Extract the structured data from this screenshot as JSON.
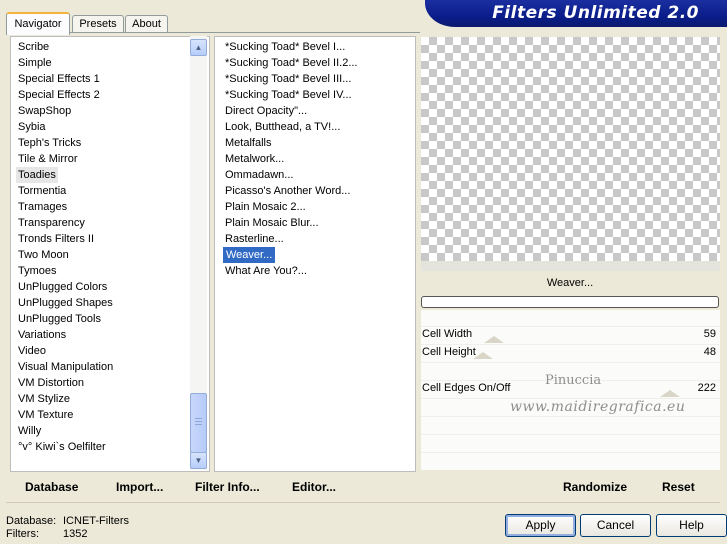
{
  "app": {
    "title": "Filters Unlimited 2.0"
  },
  "tabs": [
    {
      "label": "Navigator",
      "active": true
    },
    {
      "label": "Presets",
      "active": false
    },
    {
      "label": "About",
      "active": false
    }
  ],
  "categories": {
    "items": [
      "Scribe",
      "Simple",
      "Special Effects 1",
      "Special Effects 2",
      "SwapShop",
      "Sybia",
      "Teph's Tricks",
      "Tile & Mirror",
      "Toadies",
      "Tormentia",
      "Tramages",
      "Transparency",
      "Tronds Filters II",
      "Two Moon",
      "Tymoes",
      "UnPlugged Colors",
      "UnPlugged Shapes",
      "UnPlugged Tools",
      "Variations",
      "Video",
      "Visual Manipulation",
      "VM Distortion",
      "VM Stylize",
      "VM Texture",
      "Willy",
      "°v° Kiwi`s Oelfilter"
    ],
    "selected": "Toadies"
  },
  "filters": {
    "items": [
      "*Sucking Toad*  Bevel I...",
      "*Sucking Toad*  Bevel II.2...",
      "*Sucking Toad*  Bevel III...",
      "*Sucking Toad*  Bevel IV...",
      "Direct Opacity\"...",
      "Look, Butthead, a TV!...",
      "Metalfalls",
      "Metalwork...",
      "Ommadawn...",
      "Picasso's Another Word...",
      "Plain Mosaic 2...",
      "Plain Mosaic Blur...",
      "Rasterline...",
      "Weaver...",
      "What Are You?..."
    ],
    "selected": "Weaver..."
  },
  "preview": {
    "filter_name": "Weaver...",
    "progress": 0
  },
  "controls": [
    {
      "label": "Cell Width",
      "value": "59",
      "fraction": 0.23
    },
    {
      "label": "Cell Height",
      "value": "48",
      "fraction": 0.19
    },
    {
      "label": "",
      "value": ""
    },
    {
      "label": "Cell Edges On/Off",
      "value": "222",
      "fraction": 0.87
    }
  ],
  "watermark": {
    "line1": "Pinuccia",
    "line2": "www.maidiregrafica.eu"
  },
  "actions_left": [
    {
      "label": "Database",
      "underline": "D"
    },
    {
      "label": "Import...",
      "underline": "I"
    },
    {
      "label": "Filter Info...",
      "underline": "F"
    },
    {
      "label": "Editor...",
      "underline": "E"
    }
  ],
  "actions_right": [
    {
      "label": "Randomize"
    },
    {
      "label": "Reset"
    }
  ],
  "info": {
    "database_label": "Database:",
    "database_value": "ICNET-Filters",
    "filters_label": "Filters:",
    "filters_value": "1352"
  },
  "buttons": {
    "apply": "Apply",
    "cancel": "Cancel",
    "help": "Help"
  }
}
